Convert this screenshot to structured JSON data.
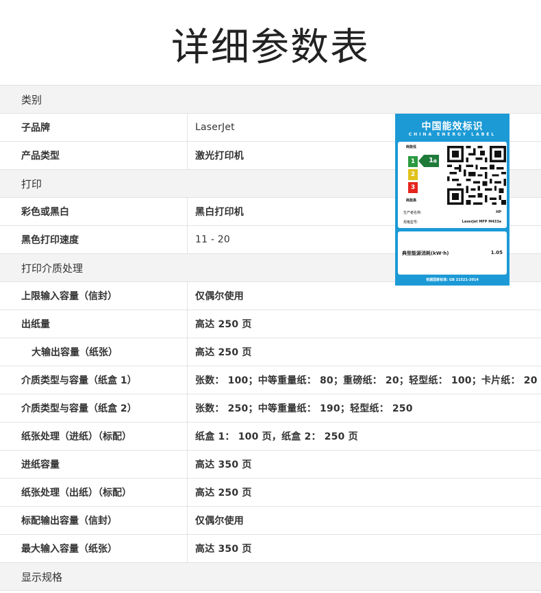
{
  "page_title": "详细参数表",
  "rows": [
    {
      "type": "section",
      "label": "类别"
    },
    {
      "type": "row",
      "label": "子品牌",
      "value": "LaserJet",
      "light": true
    },
    {
      "type": "row",
      "label": "产品类型",
      "value": "激光打印机"
    },
    {
      "type": "section",
      "label": "打印"
    },
    {
      "type": "row",
      "label": "彩色或黑白",
      "value": "黑白打印机"
    },
    {
      "type": "row",
      "label": "黑色打印速度",
      "value": "11 - 20",
      "light": true
    },
    {
      "type": "section",
      "label": "打印介质处理"
    },
    {
      "type": "row",
      "label": "上限输入容量（信封）",
      "value": "仅偶尔使用"
    },
    {
      "type": "row",
      "label": "出纸量",
      "value": "高达 250 页"
    },
    {
      "type": "row",
      "label": "大输出容量（纸张）",
      "value": "高达 250 页",
      "indent": true
    },
    {
      "type": "row",
      "label": "介质类型与容量（纸盒 1）",
      "value": "张数： 100；中等重量纸： 80；重磅纸： 20；轻型纸： 100；卡片纸： 20"
    },
    {
      "type": "row",
      "label": "介质类型与容量（纸盒 2）",
      "value": "张数： 250；中等重量纸： 190；轻型纸： 250"
    },
    {
      "type": "row",
      "label": "纸张处理（进纸）（标配）",
      "value": "纸盒 1： 100 页，纸盒 2： 250 页"
    },
    {
      "type": "row",
      "label": "进纸容量",
      "value": "高达 350 页"
    },
    {
      "type": "row",
      "label": "纸张处理（出纸）（标配）",
      "value": "高达 250 页"
    },
    {
      "type": "row",
      "label": "标配输出容量（信封）",
      "value": "仅偶尔使用"
    },
    {
      "type": "row",
      "label": "最大输入容量（纸张）",
      "value": "高达 350 页"
    },
    {
      "type": "section",
      "label": "显示规格"
    }
  ],
  "energy_label": {
    "title": "中国能效标识",
    "subtitle": "CHINA ENERGY LABEL",
    "low_label": "耗能低",
    "high_label": "耗能高",
    "grades": [
      "1",
      "2",
      "3"
    ],
    "current_grade": "1",
    "grade_suffix": "级",
    "manufacturer_label": "生产者名称:",
    "manufacturer": "HP",
    "model_label": "规格型号:",
    "model": "LaserJet MFP M433a",
    "consumption_label": "典型能源消耗(kW·h)",
    "consumption_value": "1.05",
    "standard": "依据国家标准: GB 21521-2014",
    "colors": {
      "background": "#1c9ad6",
      "grade1": "#2b9a3f",
      "grade2": "#e0c21a",
      "grade3": "#e5251d"
    }
  }
}
